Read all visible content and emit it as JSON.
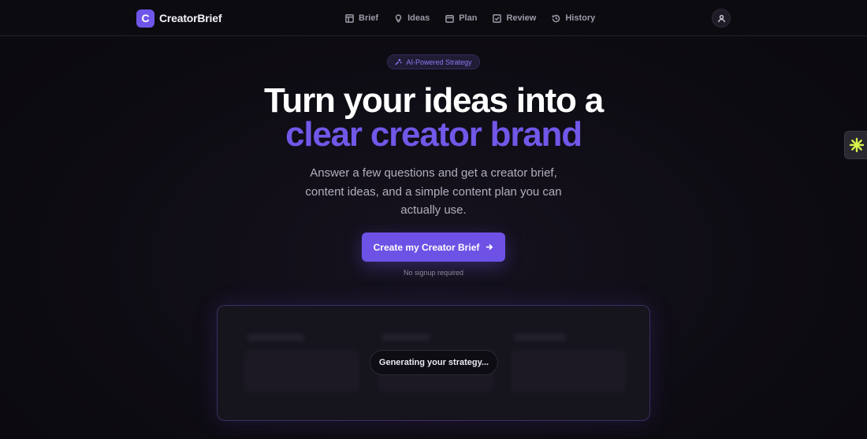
{
  "header": {
    "brand_letter": "C",
    "brand_name": "CreatorBrief",
    "nav": [
      {
        "label": "Brief",
        "icon": "layout-icon"
      },
      {
        "label": "Ideas",
        "icon": "lightbulb-icon"
      },
      {
        "label": "Plan",
        "icon": "calendar-icon"
      },
      {
        "label": "Review",
        "icon": "check-square-icon"
      },
      {
        "label": "History",
        "icon": "history-icon"
      }
    ],
    "avatar_icon": "user-icon"
  },
  "hero": {
    "badge": "AI-Powered Strategy",
    "title_line1": "Turn your ideas into a",
    "title_line2": "clear creator brand",
    "subtitle": "Answer a few questions and get a creator brief, content ideas, and a simple content plan you can actually use.",
    "cta_label": "Create my Creator Brief",
    "cta_note": "No signup required"
  },
  "preview": {
    "status": "Generating your strategy..."
  },
  "colors": {
    "accent": "#6e52e6",
    "accent_text": "#7257e8",
    "background": "#0d0b12",
    "widget_icon": "#d7f24a"
  }
}
